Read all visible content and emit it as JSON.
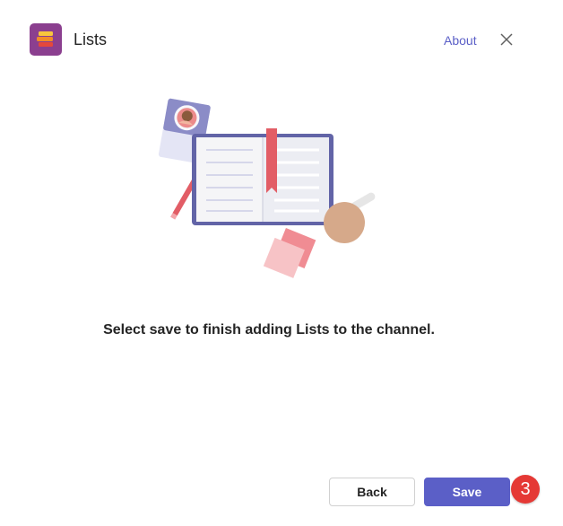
{
  "header": {
    "app_title": "Lists",
    "about_label": "About",
    "app_icon": "lists-app-icon",
    "close_icon": "close-icon"
  },
  "main": {
    "illustration": "notebook-illustration",
    "message": "Select save to finish adding Lists to the channel."
  },
  "footer": {
    "back_label": "Back",
    "save_label": "Save"
  },
  "annotation": {
    "step_number": "3"
  },
  "colors": {
    "accent": "#5b5fc7",
    "app_icon_bg": "#8b3f8f",
    "badge": "#e53935"
  }
}
